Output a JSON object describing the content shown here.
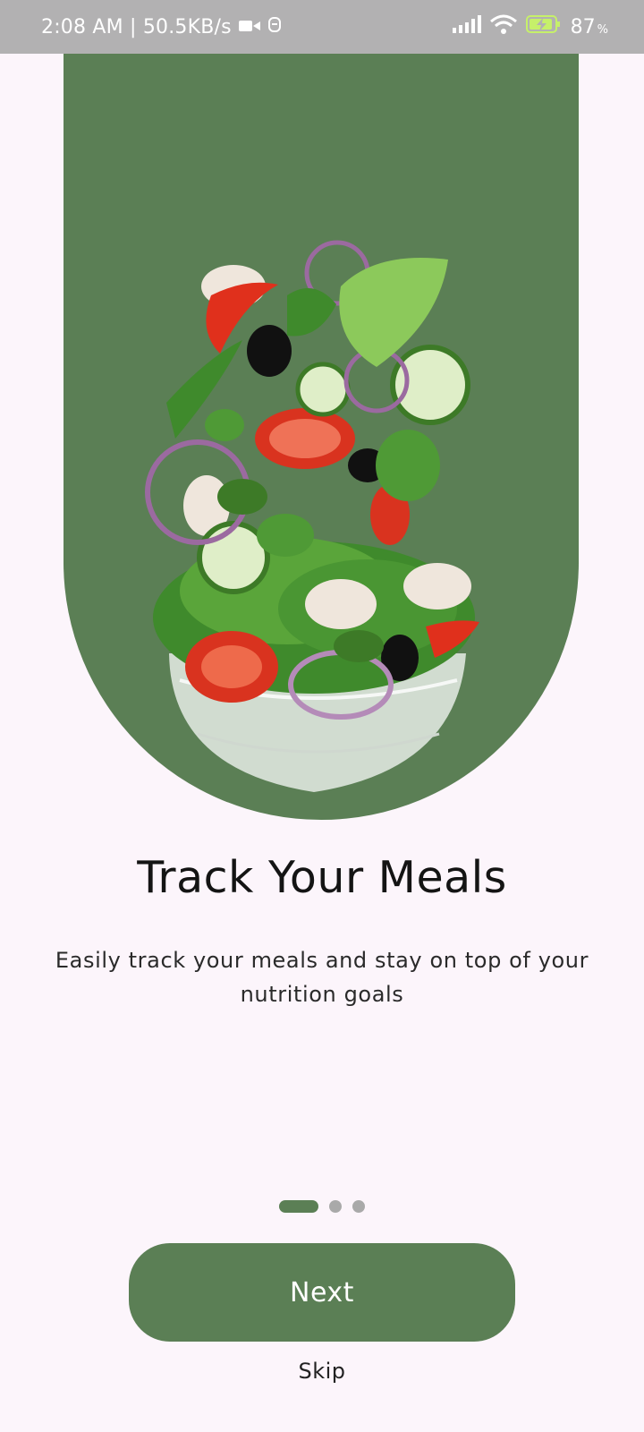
{
  "status_bar": {
    "time_speed": "2:08 AM | 50.5KB/s",
    "battery_level": "87",
    "battery_unit": "%",
    "icons": [
      "video-camera-icon",
      "notification-icon",
      "signal-icon",
      "wifi-icon",
      "battery-charging-icon"
    ]
  },
  "onboarding": {
    "title": "Track Your Meals",
    "subtitle": "Easily track your meals and stay on top of your nutrition goals",
    "page_indicator": {
      "total": 3,
      "active": 1
    },
    "next_label": "Next",
    "skip_label": "Skip"
  },
  "colors": {
    "accent": "#5b7f55",
    "background": "#fcf5fb",
    "inactive_dot": "#a9a9a9"
  }
}
